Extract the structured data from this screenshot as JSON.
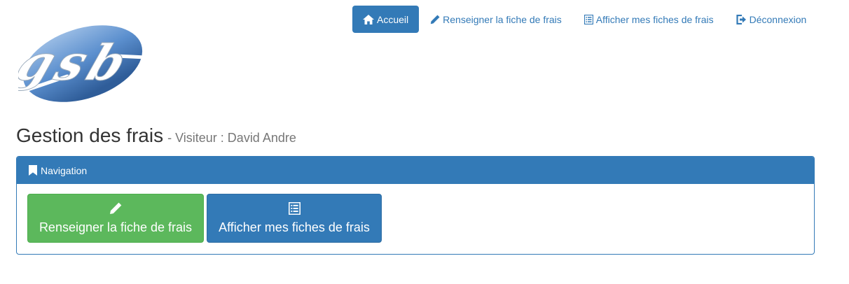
{
  "nav": {
    "items": [
      {
        "label": "Accueil",
        "icon": "home-icon",
        "active": true
      },
      {
        "label": "Renseigner la fiche de frais",
        "icon": "pencil-icon",
        "active": false
      },
      {
        "label": "Afficher mes fiches de frais",
        "icon": "list-icon",
        "active": false
      },
      {
        "label": "Déconnexion",
        "icon": "logout-icon",
        "active": false
      }
    ]
  },
  "logo": {
    "text": "gsb"
  },
  "header": {
    "title": "Gestion des frais",
    "subtitle": "- Visiteur : David Andre"
  },
  "panel": {
    "heading": "Navigation",
    "heading_icon": "bookmark-icon",
    "buttons": [
      {
        "label": "Renseigner la fiche de frais",
        "icon": "pencil-icon",
        "color": "#5cb85c"
      },
      {
        "label": "Afficher mes fiches de frais",
        "icon": "list-icon",
        "color": "#337ab7"
      }
    ]
  },
  "colors": {
    "primary": "#337ab7",
    "success": "#5cb85c",
    "muted": "#777777"
  }
}
